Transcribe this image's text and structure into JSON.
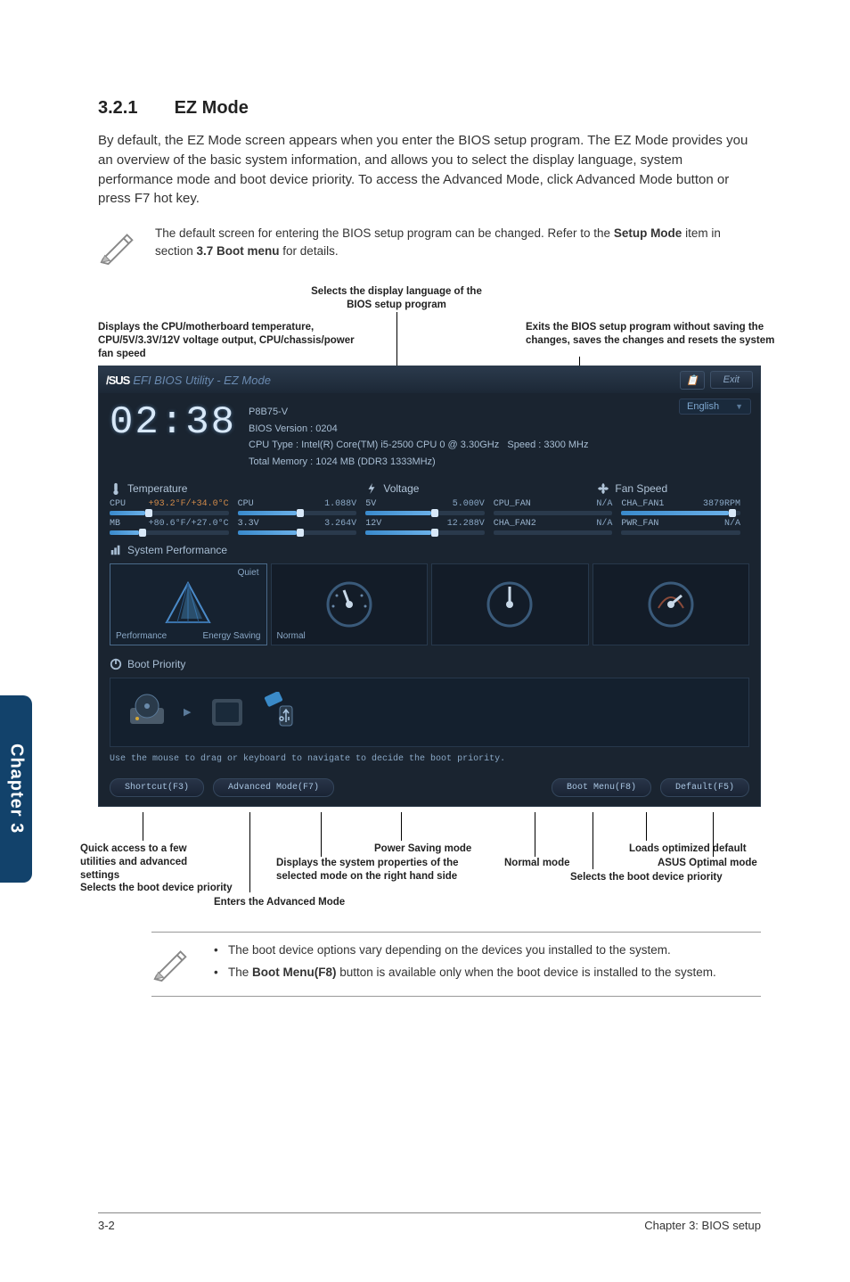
{
  "section": {
    "number": "3.2.1",
    "title": "EZ Mode"
  },
  "intro": "By default, the EZ Mode screen appears when you enter the BIOS setup program. The EZ Mode provides you an overview of the basic system information, and allows you to select the display language, system performance mode and boot device priority. To access the Advanced Mode, click Advanced Mode button or press F7 hot key.",
  "note1_pre": "The default screen for entering the BIOS setup program can be changed. Refer to the ",
  "note1_bold1": "Setup Mode",
  "note1_mid": " item in section ",
  "note1_bold2": "3.7 Boot menu",
  "note1_post": " for details.",
  "callouts": {
    "top_center": "Selects the display language of the BIOS setup program",
    "top_left": "Displays the CPU/motherboard temperature, CPU/5V/3.3V/12V voltage output, CPU/chassis/power fan speed",
    "top_right": "Exits the BIOS setup program without saving the changes, saves the changes and resets the system",
    "b_quick": "Quick access to a few utilities and advanced settings",
    "b_selboot": "Selects the boot device priority",
    "b_advanced": "Enters the Advanced Mode",
    "b_sysprops": "Displays the system properties of the selected mode on the right hand side",
    "b_power": "Power Saving mode",
    "b_normal": "Normal mode",
    "b_selboot2": "Selects the boot device  priority",
    "b_loads": "Loads optimized default",
    "b_optimal": "ASUS Optimal mode"
  },
  "bios": {
    "header_brand": "/SUS",
    "header_title": "EFI BIOS Utility - EZ Mode",
    "exit": "Exit",
    "language": "English",
    "clock": "02:38",
    "board": "P8B75-V",
    "bios_ver": "BIOS Version : 0204",
    "cpu": "CPU Type : Intel(R) Core(TM) i5-2500 CPU 0 @ 3.30GHz",
    "speed": "Speed : 3300 MHz",
    "mem": "Total Memory : 1024 MB (DDR3 1333MHz)",
    "sec_temp": "Temperature",
    "sec_volt": "Voltage",
    "sec_fan": "Fan Speed",
    "mon": {
      "cpu_t_lbl": "CPU",
      "cpu_t_val": "+93.2°F/+34.0°C",
      "mb_t_lbl": "MB",
      "mb_t_val": "+80.6°F/+27.0°C",
      "vcpu_lbl": "CPU",
      "vcpu_val": "1.088V",
      "v5_lbl": "5V",
      "v5_val": "5.000V",
      "v33_lbl": "3.3V",
      "v33_val": "3.264V",
      "v12_lbl": "12V",
      "v12_val": "12.288V",
      "fcpu_lbl": "CPU_FAN",
      "fcpu_val": "N/A",
      "fcha1_lbl": "CHA_FAN1",
      "fcha1_val": "3879RPM",
      "fcha2_lbl": "CHA_FAN2",
      "fcha2_val": "N/A",
      "fpwr_lbl": "PWR_FAN",
      "fpwr_val": "N/A"
    },
    "perf_label": "System Performance",
    "perf": {
      "quiet": "Quiet",
      "performance": "Performance",
      "energy": "Energy Saving",
      "normal": "Normal"
    },
    "boot_label": "Boot Priority",
    "boot_tip": "Use the mouse to drag or keyboard to navigate to decide the boot priority.",
    "footer": {
      "shortcut": "Shortcut(F3)",
      "adv": "Advanced Mode(F7)",
      "bootmenu": "Boot Menu(F8)",
      "default": "Default(F5)"
    }
  },
  "note2": {
    "li1": "The boot device options vary depending on the devices you installed to the system.",
    "li2_pre": "The ",
    "li2_bold": "Boot Menu(F8)",
    "li2_post": " button is available only when the boot device is installed to the system."
  },
  "side_tab": "Chapter 3",
  "footer": {
    "left": "3-2",
    "right": "Chapter 3: BIOS setup"
  }
}
